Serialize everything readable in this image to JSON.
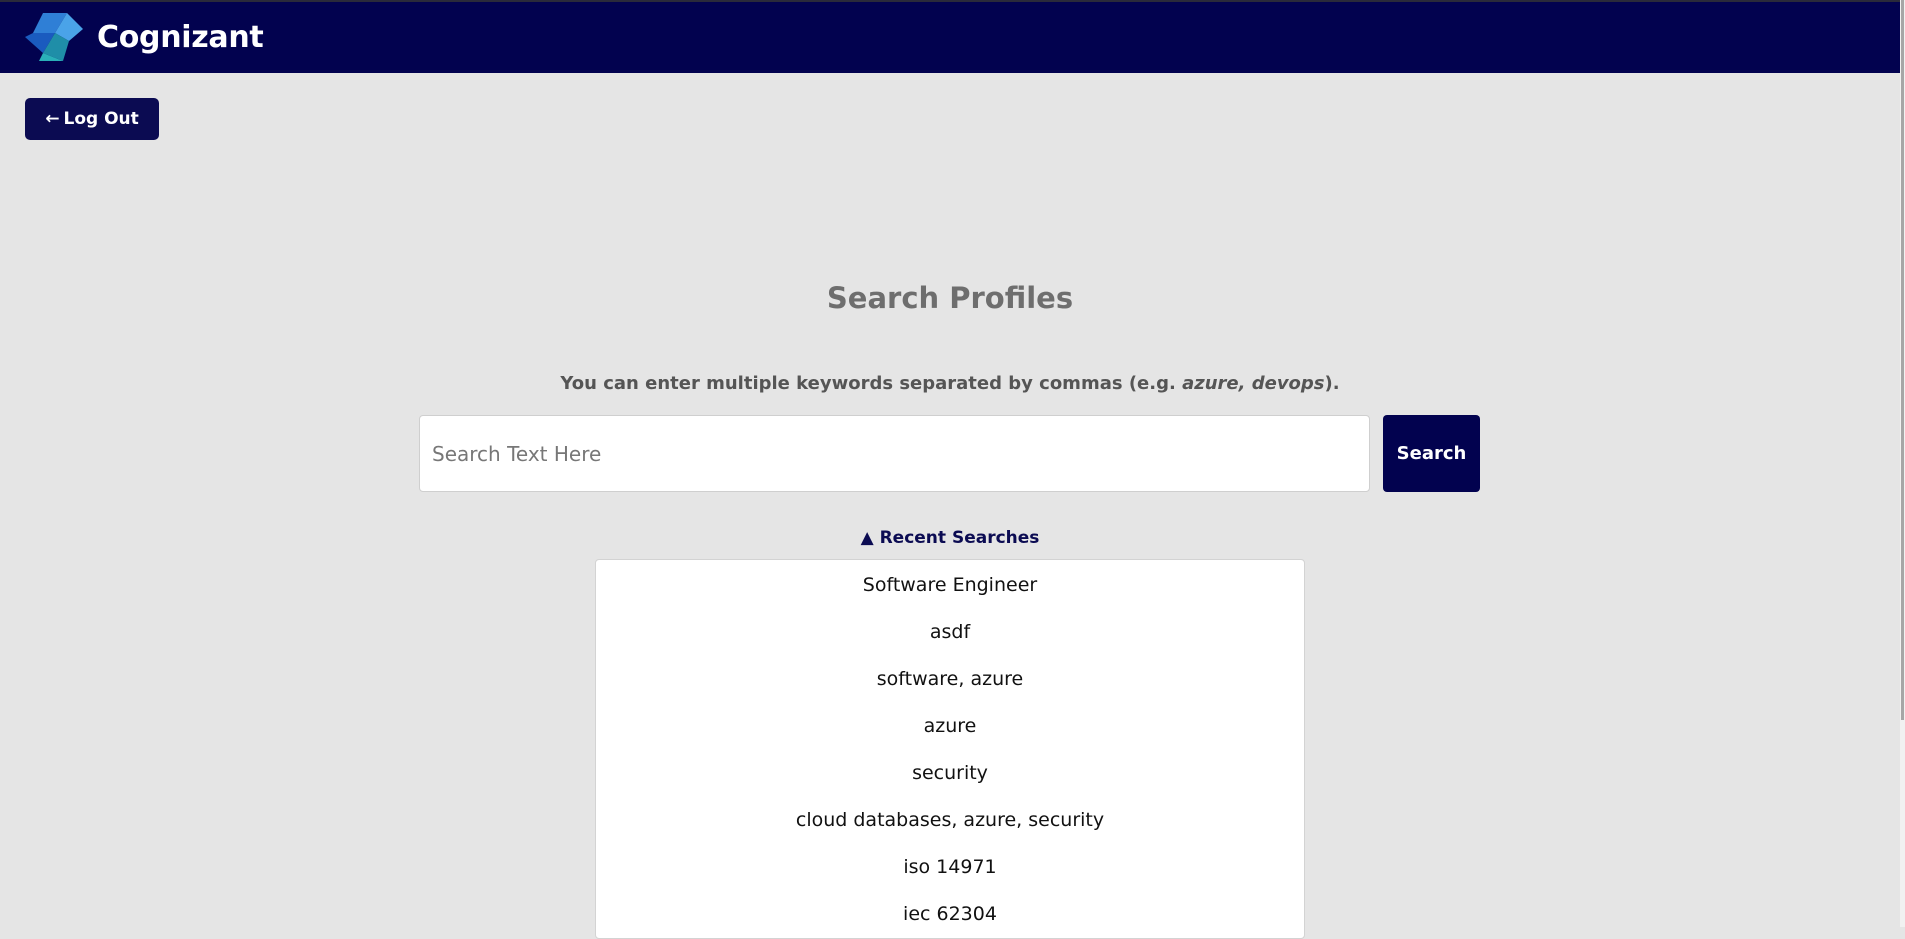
{
  "header": {
    "brand": "Cognizant",
    "logo_icon": "cognizant-logo-icon",
    "background": "#02024f"
  },
  "logout": {
    "arrow": "←",
    "label": "Log Out"
  },
  "page": {
    "title": "Search Profiles",
    "hint_prefix": "You can enter multiple keywords separated by commas (e.g. ",
    "hint_example": "azure, devops",
    "hint_suffix": ")."
  },
  "search": {
    "placeholder": "Search Text Here",
    "value": "",
    "button_label": "Search"
  },
  "recent": {
    "toggle_icon": "▲",
    "toggle_label": "Recent Searches",
    "items": [
      "Software Engineer",
      "asdf",
      "software, azure",
      "azure",
      "security",
      "cloud databases, azure, security",
      "iso 14971",
      "iec 62304"
    ]
  },
  "colors": {
    "navy": "#02024f",
    "page_bg": "#e5e5e5",
    "title_gray": "#6e6e6e"
  }
}
